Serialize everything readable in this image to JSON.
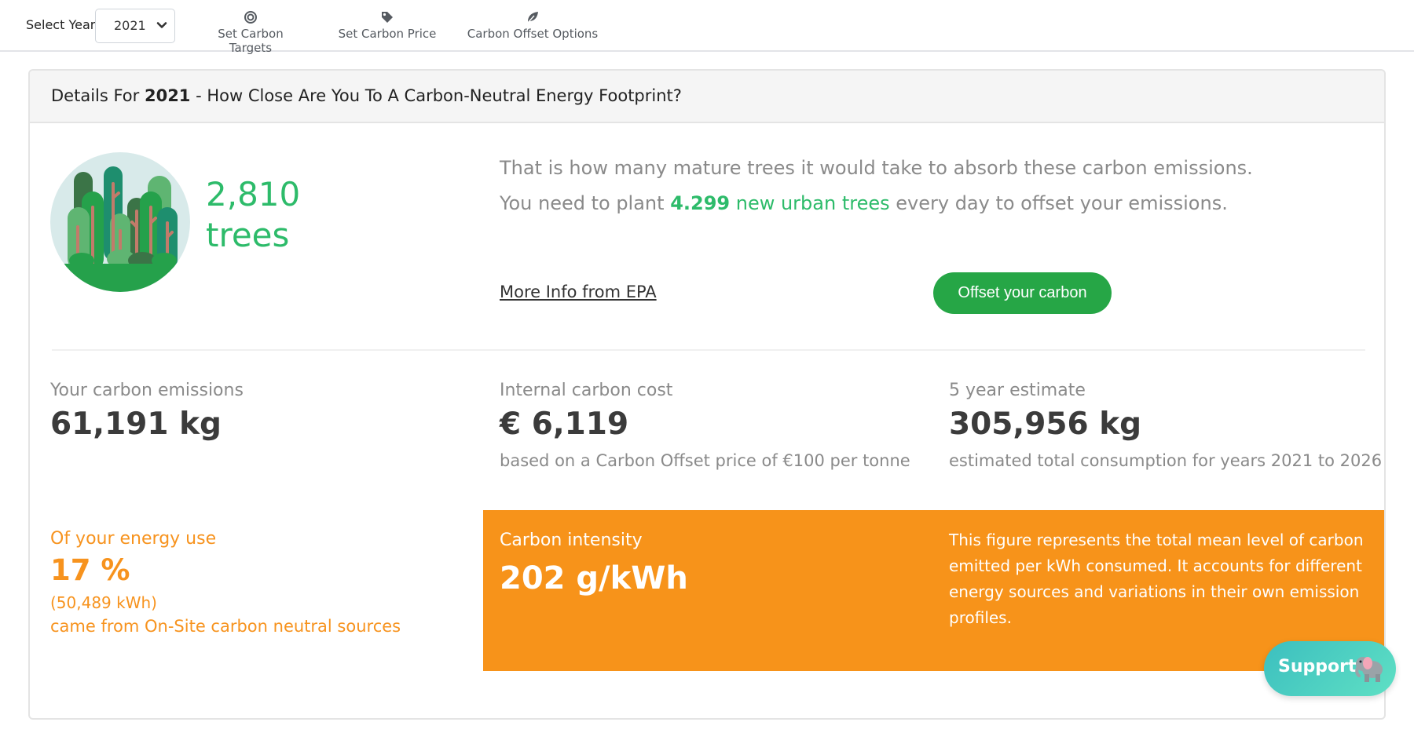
{
  "toolbar": {
    "year_label": "Select Year",
    "year_selected": "2021",
    "nav": [
      {
        "label": "Set Carbon Targets",
        "icon": "target-icon"
      },
      {
        "label": "Set Carbon Price",
        "icon": "tag-icon"
      },
      {
        "label": "Carbon Offset Options",
        "icon": "leaf-icon"
      }
    ]
  },
  "card": {
    "title_prefix": "Details For ",
    "title_year": "2021",
    "title_suffix": " - How Close Are You To A Carbon-Neutral Energy Footprint?"
  },
  "trees": {
    "count": "2,810",
    "unit": "trees",
    "message1": "That is how many mature trees it would take to absorb these carbon emissions.",
    "message2_prefix": "You need to plant ",
    "message2_number": "4.299",
    "message2_highlight": " new urban trees",
    "message2_suffix": " every day to offset your emissions.",
    "epa_link": "More Info from EPA",
    "offset_button": "Offset your carbon"
  },
  "stats": {
    "emissions": {
      "label": "Your carbon emissions",
      "value": "61,191 kg"
    },
    "cost": {
      "label": "Internal carbon cost",
      "value": "€ 6,119",
      "sub": "based on a Carbon Offset price of €100 per tonne"
    },
    "estimate": {
      "label": "5 year estimate",
      "value": "305,956 kg",
      "sub": "estimated total consumption for years 2021 to 2026"
    }
  },
  "energy": {
    "label": "Of your energy use",
    "percent": "17 %",
    "kwh": "(50,489 kWh)",
    "source": "came from On-Site carbon neutral sources"
  },
  "intensity": {
    "label": "Carbon intensity",
    "value": "202 g/kWh",
    "description": "This figure represents the total mean level of carbon emitted per kWh consumed. It accounts for different energy sources and variations in their own emission profiles."
  },
  "support": {
    "label": "Support",
    "icon": "elephant-icon"
  },
  "colors": {
    "green": "#2dbb6a",
    "button_green": "#26a646",
    "orange": "#f7931a",
    "teal": "#3cbfbf"
  }
}
